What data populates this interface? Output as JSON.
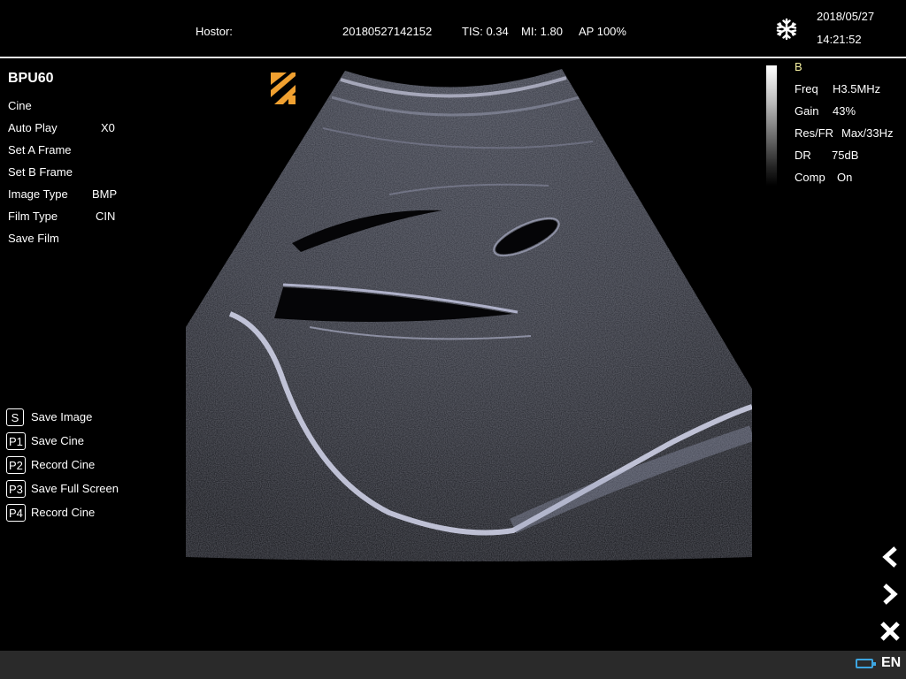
{
  "header": {
    "hostor_label": "Hostor:",
    "exam_id": "20180527142152",
    "tis": "TIS: 0.34",
    "mi": "MI: 1.80",
    "ap": "AP 100%",
    "date": "2018/05/27",
    "time": "14:21:52",
    "freeze_icon": "snowflake-icon"
  },
  "left_menu": {
    "title": "BPU60",
    "items": [
      {
        "label": "Cine",
        "value": ""
      },
      {
        "label": "Auto Play",
        "value": "X0"
      },
      {
        "label": "Set A Frame",
        "value": ""
      },
      {
        "label": "Set B Frame",
        "value": ""
      },
      {
        "label": "Image Type",
        "value": "BMP"
      },
      {
        "label": "Film Type",
        "value": "CIN"
      },
      {
        "label": "Save Film",
        "value": ""
      }
    ]
  },
  "shortcuts": [
    {
      "key": "S",
      "label": "Save Image"
    },
    {
      "key": "P1",
      "label": "Save Cine"
    },
    {
      "key": "P2",
      "label": "Record Cine"
    },
    {
      "key": "P3",
      "label": "Save Full Screen"
    },
    {
      "key": "P4",
      "label": "Record Cine"
    }
  ],
  "params": {
    "mode": "B",
    "rows": [
      {
        "label": "Freq",
        "value": "H3.5MHz"
      },
      {
        "label": "Gain",
        "value": "43%"
      },
      {
        "label": "Res/FR",
        "value": "Max/33Hz"
      },
      {
        "label": "DR",
        "value": "75dB"
      },
      {
        "label": "Comp",
        "value": "On"
      }
    ]
  },
  "nav": {
    "prev_icon": "chevron-left-icon",
    "next_icon": "chevron-right-icon",
    "close_icon": "close-icon"
  },
  "status": {
    "battery_icon": "battery-icon",
    "language": "EN"
  },
  "colors": {
    "probe_marker": "#f0a030",
    "mode_letter": "#f4f0a0",
    "battery": "#3da5e0",
    "status_bar": "#2a2a2a"
  }
}
